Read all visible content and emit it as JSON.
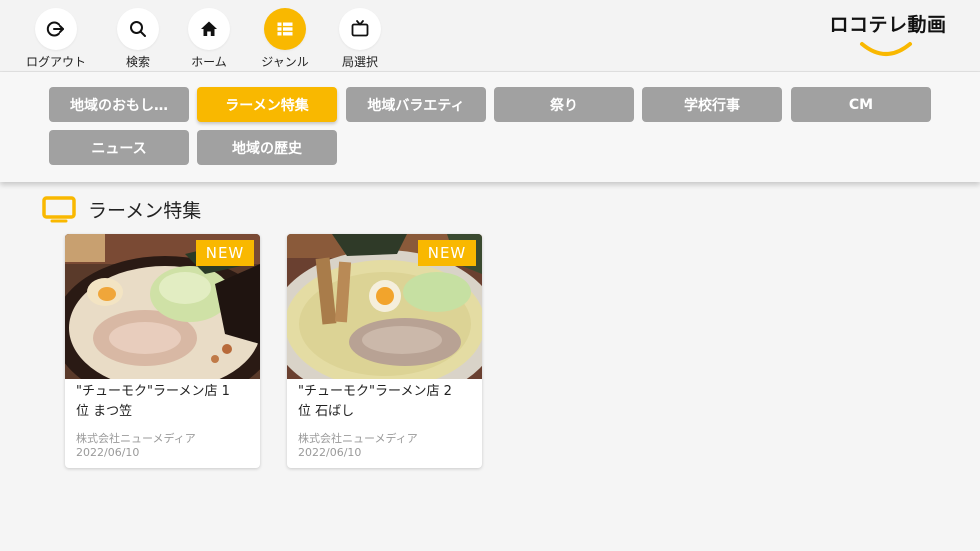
{
  "nav": {
    "items": [
      {
        "id": "logout",
        "label": "ログアウト",
        "icon": "logout-icon"
      },
      {
        "id": "search",
        "label": "検索",
        "icon": "search-icon"
      },
      {
        "id": "home",
        "label": "ホーム",
        "icon": "home-icon"
      },
      {
        "id": "genre",
        "label": "ジャンル",
        "icon": "grid-list-icon",
        "active": true
      },
      {
        "id": "station",
        "label": "局選択",
        "icon": "tv-icon"
      }
    ]
  },
  "logo": {
    "text": "ロコテレ動画"
  },
  "genres": [
    {
      "label": "地域のおもし…",
      "active": false
    },
    {
      "label": "ラーメン特集",
      "active": true
    },
    {
      "label": "地域バラエティ",
      "active": false
    },
    {
      "label": "祭り",
      "active": false
    },
    {
      "label": "学校行事",
      "active": false
    },
    {
      "label": "CM",
      "active": false
    },
    {
      "label": "ニュース",
      "active": false
    },
    {
      "label": "地域の歴史",
      "active": false
    }
  ],
  "section": {
    "title": "ラーメン特集",
    "icon": "tv-icon"
  },
  "videos": [
    {
      "badge": "NEW",
      "title_line1": "\"チューモク\"ラーメン店 1",
      "title_line2": "位 まつ笠",
      "publisher": "株式会社ニューメディア",
      "date": "2022/06/10"
    },
    {
      "badge": "NEW",
      "title_line1": "\"チューモク\"ラーメン店 2",
      "title_line2": "位 石ばし",
      "publisher": "株式会社ニューメディア",
      "date": "2022/06/10"
    }
  ],
  "colors": {
    "accent": "#f9b800",
    "genre_inactive": "#a1a1a1",
    "background": "#f5f5f5"
  }
}
